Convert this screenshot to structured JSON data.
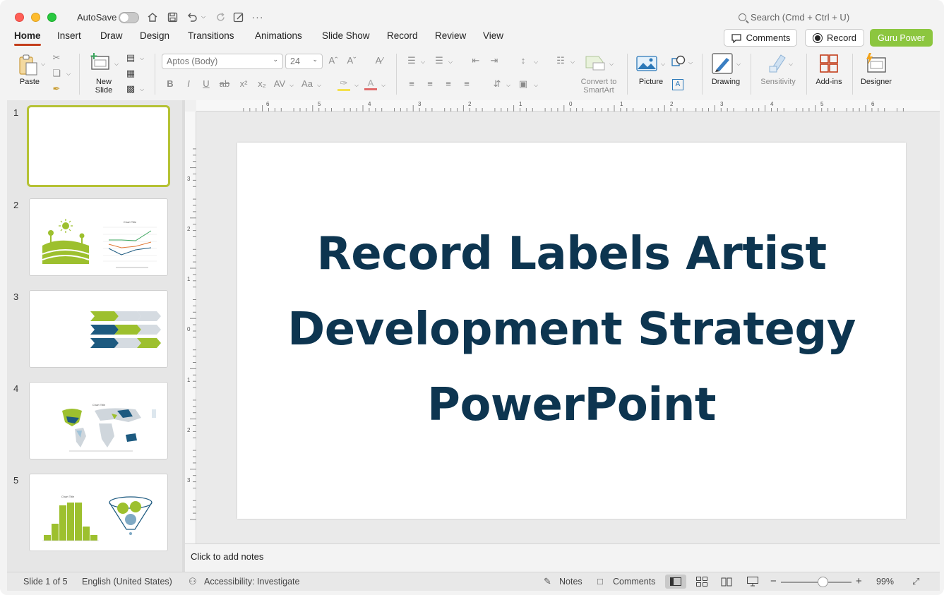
{
  "titlebar": {
    "autosave_label": "AutoSave",
    "search_placeholder": "Search (Cmd + Ctrl + U)"
  },
  "ribbon_tabs": [
    "Home",
    "Insert",
    "Draw",
    "Design",
    "Transitions",
    "Animations",
    "Slide Show",
    "Record",
    "Review",
    "View"
  ],
  "header_buttons": {
    "comments": "Comments",
    "record": "Record",
    "guru": "Guru Power"
  },
  "ribbon": {
    "paste": "Paste",
    "new_slide_1": "New",
    "new_slide_2": "Slide",
    "font_name": "Aptos (Body)",
    "font_size": "24",
    "convert_1": "Convert to",
    "convert_2": "SmartArt",
    "picture": "Picture",
    "drawing": "Drawing",
    "sensitivity": "Sensitivity",
    "addins": "Add-ins",
    "designer": "Designer"
  },
  "ruler": {
    "h_labels": [
      "6",
      "5",
      "4",
      "3",
      "2",
      "1",
      "0",
      "1",
      "2",
      "3",
      "4",
      "5",
      "6"
    ],
    "v_labels": [
      "3",
      "2",
      "1",
      "0",
      "1",
      "2",
      "3"
    ]
  },
  "slides": [
    {
      "num": "1"
    },
    {
      "num": "2",
      "chart_title": "Chart Title"
    },
    {
      "num": "3"
    },
    {
      "num": "4",
      "chart_title": "Chart Title"
    },
    {
      "num": "5",
      "chart_title": "Chart Title"
    }
  ],
  "main_slide": {
    "title_line1": "Record Labels Artist",
    "title_line2": "Development Strategy",
    "title_line3": "PowerPoint",
    "title_color": "#0d3550"
  },
  "notes_placeholder": "Click to add notes",
  "status": {
    "slide_of": "Slide 1 of 5",
    "language": "English (United States)",
    "accessibility": "Accessibility: Investigate",
    "notes": "Notes",
    "comments": "Comments",
    "zoom": "99%"
  },
  "colors": {
    "accent_red": "#c43e1c",
    "guru_green": "#8cc63f",
    "thumb_green": "#9dc02e",
    "thumb_navy": "#1d5a80",
    "selection": "#b5c234"
  }
}
